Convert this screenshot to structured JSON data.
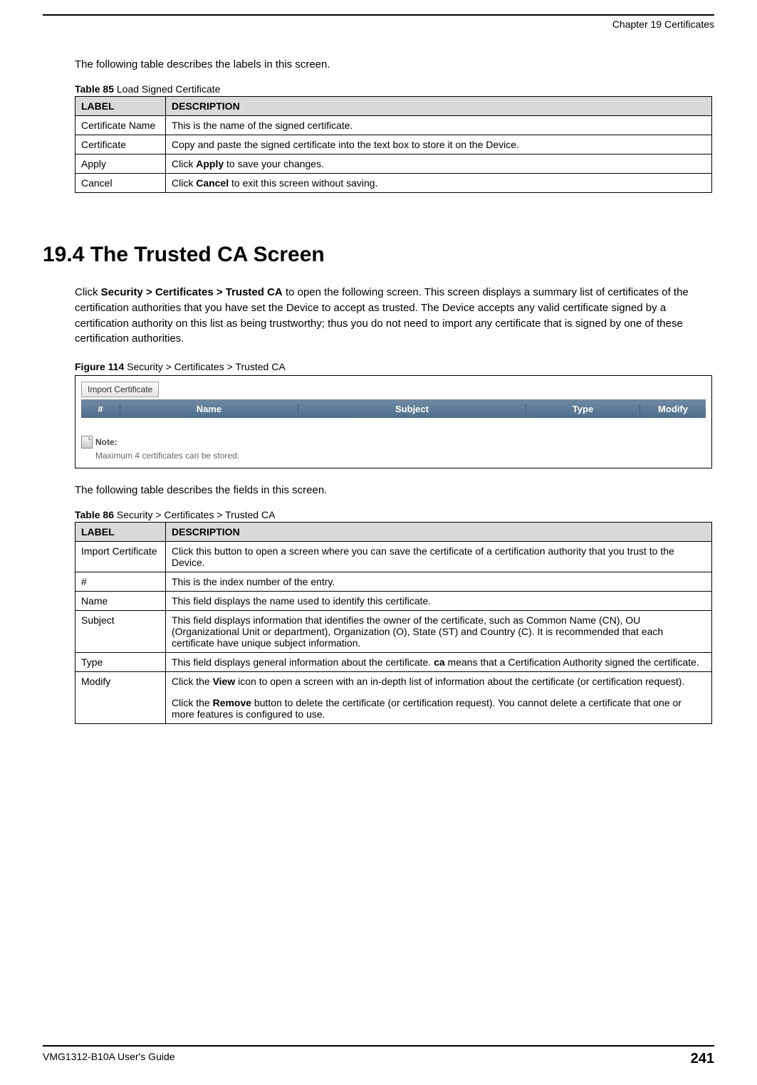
{
  "header": {
    "chapter": "Chapter 19 Certificates"
  },
  "intro1": "The following table describes the labels in this screen.",
  "table85": {
    "caption_bold": "Table 85",
    "caption_rest": "   Load Signed Certificate",
    "head_label": "LABEL",
    "head_desc": "DESCRIPTION",
    "rows": [
      {
        "label": "Certificate Name",
        "desc": "This is the name of the signed certificate."
      },
      {
        "label": "Certificate",
        "desc": "Copy and paste the signed certificate into the text box to store it on the Device."
      }
    ],
    "apply_label": "Apply",
    "apply_pre": "Click ",
    "apply_bold": "Apply",
    "apply_post": " to save your changes.",
    "cancel_label": "Cancel",
    "cancel_pre": "Click ",
    "cancel_bold": "Cancel",
    "cancel_post": " to exit this screen without saving."
  },
  "section_heading": "19.4  The Trusted CA Screen",
  "para_pre": "Click ",
  "para_bold": "Security > Certificates > Trusted CA",
  "para_post": " to open the following screen. This screen displays a summary list of certificates of the certification authorities that you have set the Device to accept as trusted. The Device accepts any valid certificate signed by a certification authority on this list as being trustworthy; thus you do not need to import any certificate that is signed by one of these certification authorities.",
  "figure_caption_bold": "Figure 114",
  "figure_caption_rest": "   Security > Certificates > Trusted CA",
  "figure": {
    "import_btn": "Import Certificate",
    "cols": {
      "c1": "#",
      "c2": "Name",
      "c3": "Subject",
      "c4": "Type",
      "c5": "Modify"
    },
    "note_label": "Note:",
    "note_text": "Maximum 4 certificates can be stored."
  },
  "intro2": "The following table describes the fields in this screen.",
  "table86": {
    "caption_bold": "Table 86",
    "caption_rest": "   Security > Certificates > Trusted CA",
    "head_label": "LABEL",
    "head_desc": "DESCRIPTION",
    "rows": [
      {
        "label": "Import Certificate",
        "desc": "Click this button to open a screen where you can save the certificate of a certification authority that you trust to the Device."
      },
      {
        "label": "#",
        "desc": "This is the index number of the entry."
      },
      {
        "label": "Name",
        "desc": "This field displays the name used to identify this certificate."
      },
      {
        "label": "Subject",
        "desc": "This field displays information that identifies the owner of the certificate, such as Common Name (CN), OU (Organizational Unit or department), Organization (O), State (ST) and Country (C). It is recommended that each certificate have unique subject information."
      }
    ],
    "type_label": "Type",
    "type_pre": "This field displays general information about the certificate. ",
    "type_bold": "ca",
    "type_post": " means that a Certification Authority signed the certificate.",
    "modify_label": "Modify",
    "modify_p1_pre": "Click the ",
    "modify_p1_bold": "View",
    "modify_p1_post": " icon to open a screen with an in-depth list of information about the certificate (or certification request).",
    "modify_p2_pre": "Click the ",
    "modify_p2_bold": "Remove",
    "modify_p2_post": " button to delete the certificate (or certification request). You cannot delete a certificate that one or more features is configured to use."
  },
  "footer": {
    "guide": "VMG1312-B10A User's Guide",
    "page": "241"
  }
}
